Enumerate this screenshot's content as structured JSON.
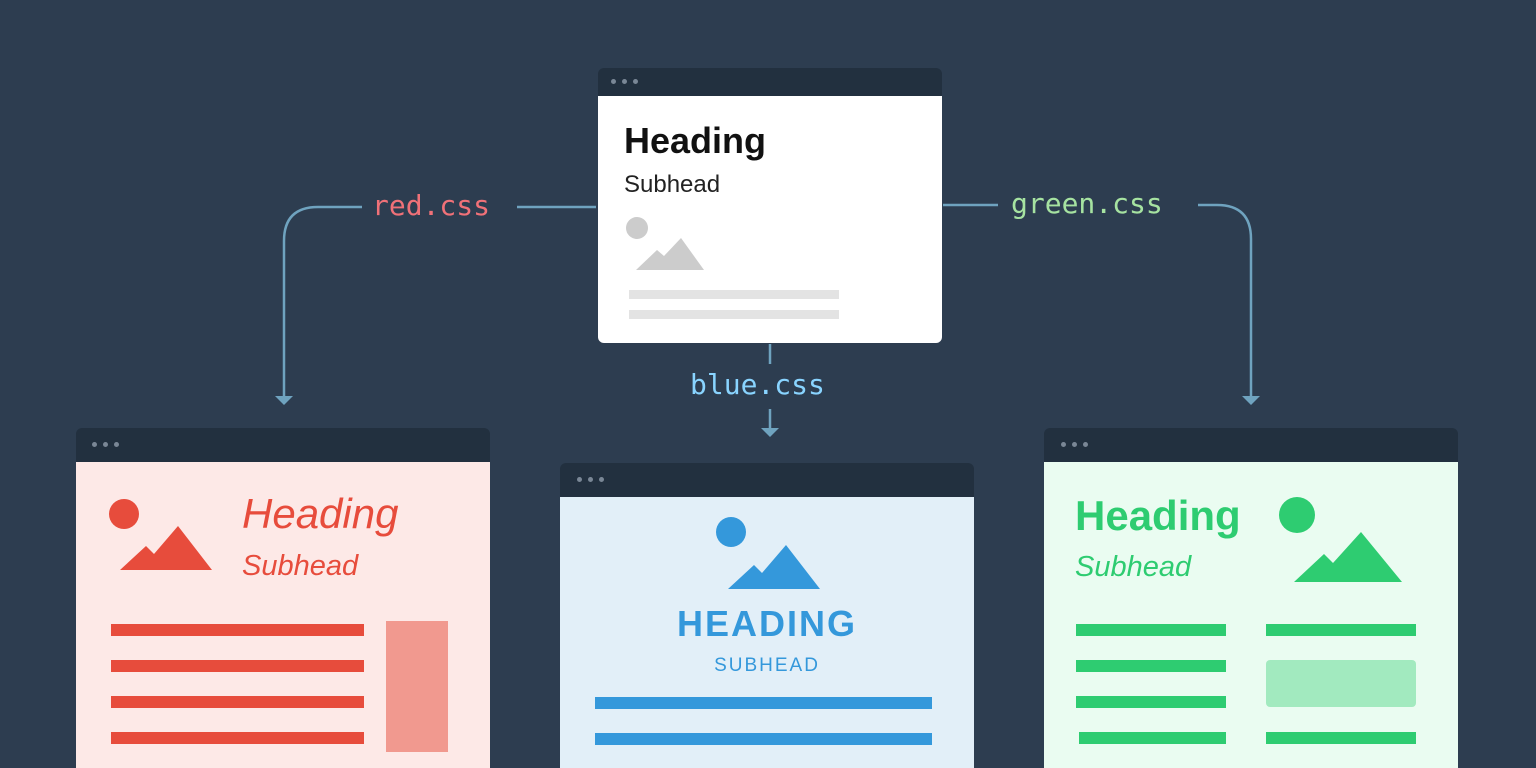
{
  "colors": {
    "background": "#2d3d50",
    "titlebar": "#22303f",
    "connector": "#6fa3bf",
    "red": "#e74c3c",
    "blue": "#3498db",
    "green": "#2ecc71",
    "gray": "#cccccc"
  },
  "labels": {
    "red": "red.css",
    "blue": "blue.css",
    "green": "green.css"
  },
  "source": {
    "heading": "Heading",
    "subhead": "Subhead"
  },
  "red_theme": {
    "heading": "Heading",
    "subhead": "Subhead"
  },
  "blue_theme": {
    "heading": "HEADING",
    "subhead": "SUBHEAD"
  },
  "green_theme": {
    "heading": "Heading",
    "subhead": "Subhead"
  },
  "icons": [
    "window-dots-icon",
    "image-placeholder-icon",
    "arrow-down-icon"
  ]
}
